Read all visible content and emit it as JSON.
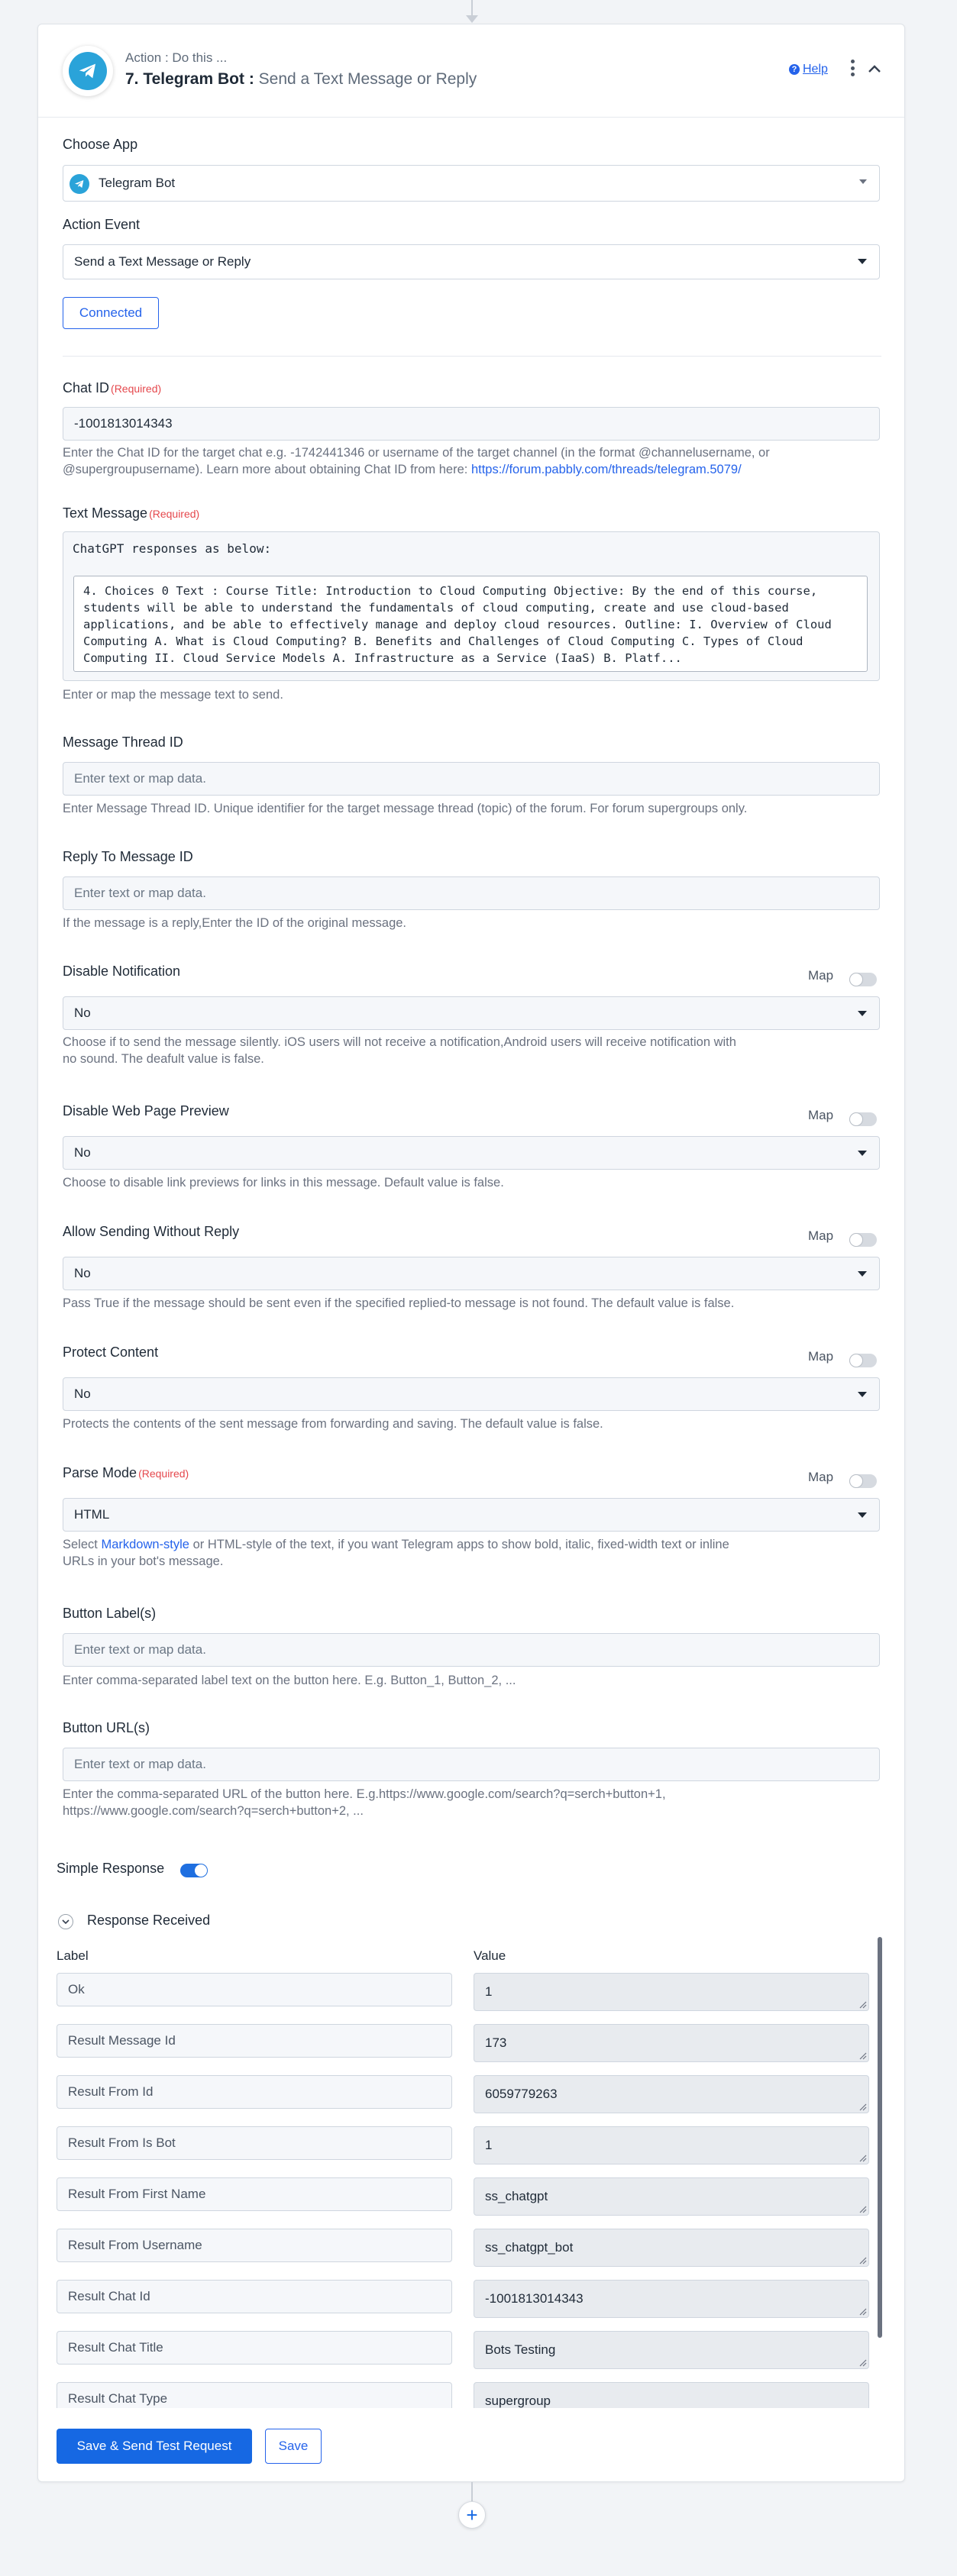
{
  "step": {
    "action_sub": "Action : Do this ...",
    "number_title": "7. Telegram Bot :",
    "action_name": "Send a Text Message or Reply",
    "help": "Help"
  },
  "choose_app": {
    "label": "Choose App",
    "value": "Telegram Bot"
  },
  "action_event": {
    "label": "Action Event",
    "value": "Send a Text Message or Reply"
  },
  "connected": "Connected",
  "required": "(Required)",
  "chat_id": {
    "label": "Chat ID",
    "value": "-1001813014343",
    "help_1": "Enter the Chat ID for the target chat e.g. -1742441346 or username of the target channel (in the format @channelusername, or",
    "help_2": "@supergroupusername). Learn more about obtaining Chat ID from here: ",
    "help_link": "https://forum.pabbly.com/threads/telegram.5079/"
  },
  "text_message": {
    "label": "Text Message",
    "line1": "ChatGPT responses as below:",
    "mapped": "4. Choices 0 Text : Course Title: Introduction to Cloud Computing Objective: By the end of this course, students will be able to understand the fundamentals of cloud computing, create and use cloud-based applications, and be able to effectively manage and deploy cloud resources. Outline: I. Overview of Cloud Computing A. What is Cloud Computing? B. Benefits and Challenges of Cloud Computing C. Types of Cloud Computing II. Cloud Service Models A. Infrastructure as a Service (IaaS) B. Platf...",
    "help": "Enter or map the message text to send."
  },
  "placeholder": "Enter text or map data.",
  "map_label": "Map",
  "thread_id": {
    "label": "Message Thread ID",
    "help": "Enter Message Thread ID. Unique identifier for the target message thread (topic) of the forum. For forum supergroups only."
  },
  "reply_to": {
    "label": "Reply To Message ID",
    "help": "If the message is a reply,Enter the ID of the original message."
  },
  "disable_notification": {
    "label": "Disable Notification",
    "value": "No",
    "help_1": "Choose if to send the message silently. iOS users will not receive a notification,Android users will receive  notification with",
    "help_2": "no sound. The deafult value is false."
  },
  "disable_preview": {
    "label": "Disable Web Page Preview",
    "value": "No",
    "help": "Choose to disable link previews for links in this message. Default value is false."
  },
  "allow_without_reply": {
    "label": "Allow Sending Without Reply",
    "value": "No",
    "help": "Pass True if the message should be sent even if the specified replied-to message is not found. The default value is false."
  },
  "protect_content": {
    "label": "Protect Content",
    "value": "No",
    "help": "Protects the contents of the sent message from forwarding and saving. The default value is false."
  },
  "parse_mode": {
    "label": "Parse Mode",
    "value": "HTML",
    "help_pre": "Select ",
    "help_link": "Markdown-style",
    "help_post": " or HTML-style of the text, if you want Telegram apps to show bold, italic, fixed-width text or inline",
    "help_2": "URLs in your bot's message."
  },
  "button_labels": {
    "label": "Button Label(s)",
    "help": "Enter comma-separated label text on the button here. E.g. Button_1, Button_2, ..."
  },
  "button_urls": {
    "label": "Button URL(s)",
    "help_1": "Enter the comma-separated URL of the button here. E.g.https://www.google.com/search?q=serch+button+1,",
    "help_2": "https://www.google.com/search?q=serch+button+2, ..."
  },
  "simple_response": {
    "label": "Simple Response",
    "enabled": true
  },
  "response": {
    "title": "Response Received",
    "col_label": "Label",
    "col_value": "Value",
    "rows": [
      {
        "label": "Ok",
        "value": "1"
      },
      {
        "label": "Result Message Id",
        "value": "173"
      },
      {
        "label": "Result From Id",
        "value": "6059779263"
      },
      {
        "label": "Result From Is Bot",
        "value": "1"
      },
      {
        "label": "Result From First Name",
        "value": "ss_chatgpt"
      },
      {
        "label": "Result From Username",
        "value": "ss_chatgpt_bot"
      },
      {
        "label": "Result Chat Id",
        "value": "-1001813014343"
      },
      {
        "label": "Result Chat Title",
        "value": "Bots Testing"
      },
      {
        "label": "Result Chat Type",
        "value": "supergroup"
      }
    ]
  },
  "buttons": {
    "save_send": "Save & Send Test Request",
    "save": "Save"
  },
  "colors": {
    "primary": "#1668e3",
    "telegram": "#2aa3d9",
    "required": "#e5484d"
  },
  "icons": [
    "telegram-icon",
    "help-icon",
    "kebab-menu-icon",
    "chevron-up-icon",
    "chevron-down-icon",
    "add-step-icon"
  ]
}
